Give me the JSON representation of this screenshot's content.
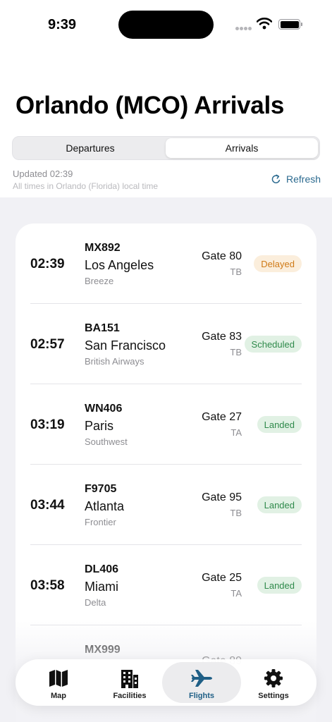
{
  "status_bar": {
    "time": "9:39"
  },
  "header": {
    "title": "Orlando (MCO) Arrivals"
  },
  "segments": {
    "departures_label": "Departures",
    "arrivals_label": "Arrivals",
    "selected": "Arrivals"
  },
  "info": {
    "updated": "Updated 02:39",
    "timezone_note": "All times in Orlando (Florida) local time",
    "refresh_label": "Refresh"
  },
  "flights": [
    {
      "time": "02:39",
      "flight": "MX892",
      "city": "Los Angeles",
      "airline": "Breeze",
      "gate": "Gate 80",
      "terminal": "TB",
      "status": "Delayed"
    },
    {
      "time": "02:57",
      "flight": "BA151",
      "city": "San Francisco",
      "airline": "British Airways",
      "gate": "Gate 83",
      "terminal": "TB",
      "status": "Scheduled"
    },
    {
      "time": "03:19",
      "flight": "WN406",
      "city": "Paris",
      "airline": "Southwest",
      "gate": "Gate 27",
      "terminal": "TA",
      "status": "Landed"
    },
    {
      "time": "03:44",
      "flight": "F9705",
      "city": "Atlanta",
      "airline": "Frontier",
      "gate": "Gate 95",
      "terminal": "TB",
      "status": "Landed"
    },
    {
      "time": "03:58",
      "flight": "DL406",
      "city": "Miami",
      "airline": "Delta",
      "gate": "Gate 25",
      "terminal": "TA",
      "status": "Landed"
    },
    {
      "time": "",
      "flight": "MX999",
      "city": "",
      "airline": "",
      "gate": "Gate 89",
      "terminal": "",
      "status": ""
    }
  ],
  "tab_bar": {
    "tabs": [
      {
        "label": "Map",
        "icon": "map-icon"
      },
      {
        "label": "Facilities",
        "icon": "building-icon"
      },
      {
        "label": "Flights",
        "icon": "airplane-icon"
      },
      {
        "label": "Settings",
        "icon": "gear-icon"
      }
    ],
    "selected": "Flights"
  },
  "colors": {
    "accent": "#1f5f86",
    "refresh": "#2b6a8f",
    "delayed_bg": "#fbeedc",
    "delayed_text": "#cf7a17",
    "ok_bg": "#e1f1e4",
    "ok_text": "#2f8a4b"
  }
}
